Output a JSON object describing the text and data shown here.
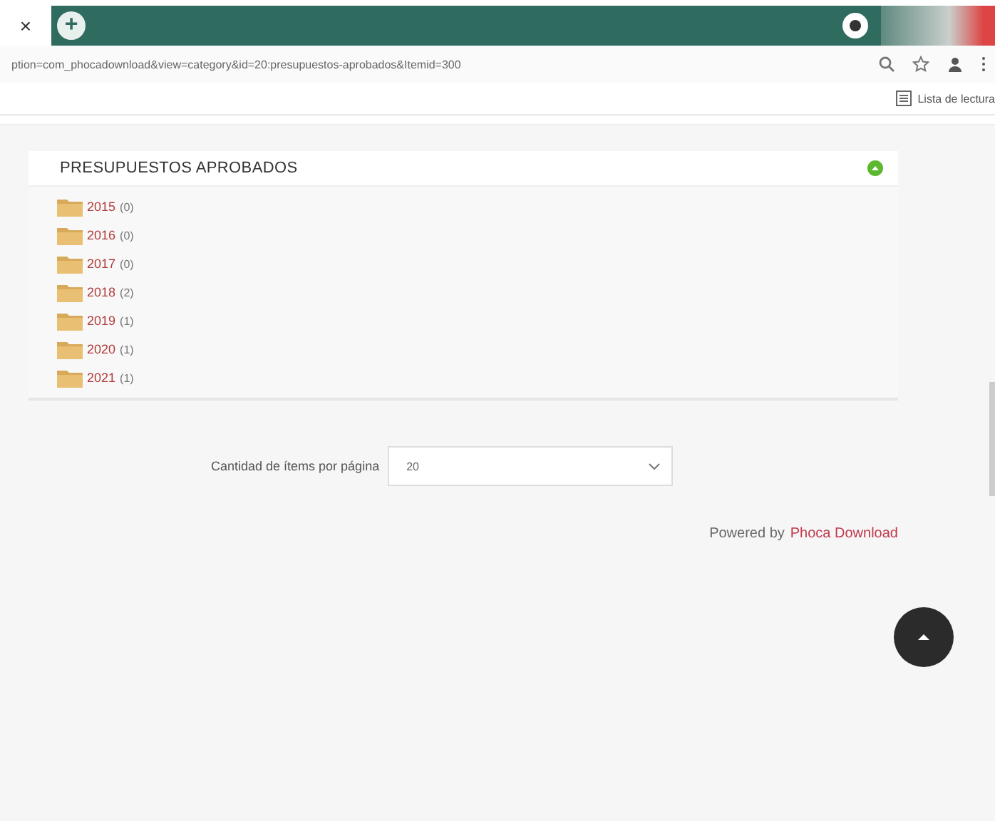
{
  "browser": {
    "close_tab": "×",
    "new_tab": "+",
    "url": "ption=com_phocadownload&view=category&id=20:presupuestos-aprobados&Itemid=300",
    "reading_list": "Lista de lectura"
  },
  "panel": {
    "title": "PRESUPUESTOS APROBADOS",
    "folders": [
      {
        "name": "2015",
        "count": "(0)"
      },
      {
        "name": "2016",
        "count": "(0)"
      },
      {
        "name": "2017",
        "count": "(0)"
      },
      {
        "name": "2018",
        "count": "(2)"
      },
      {
        "name": "2019",
        "count": "(1)"
      },
      {
        "name": "2020",
        "count": "(1)"
      },
      {
        "name": "2021",
        "count": "(1)"
      }
    ]
  },
  "pagination": {
    "label": "Cantidad de ítems por página",
    "value": "20"
  },
  "footer": {
    "prefix": "Powered by",
    "link": "Phoca Download"
  }
}
